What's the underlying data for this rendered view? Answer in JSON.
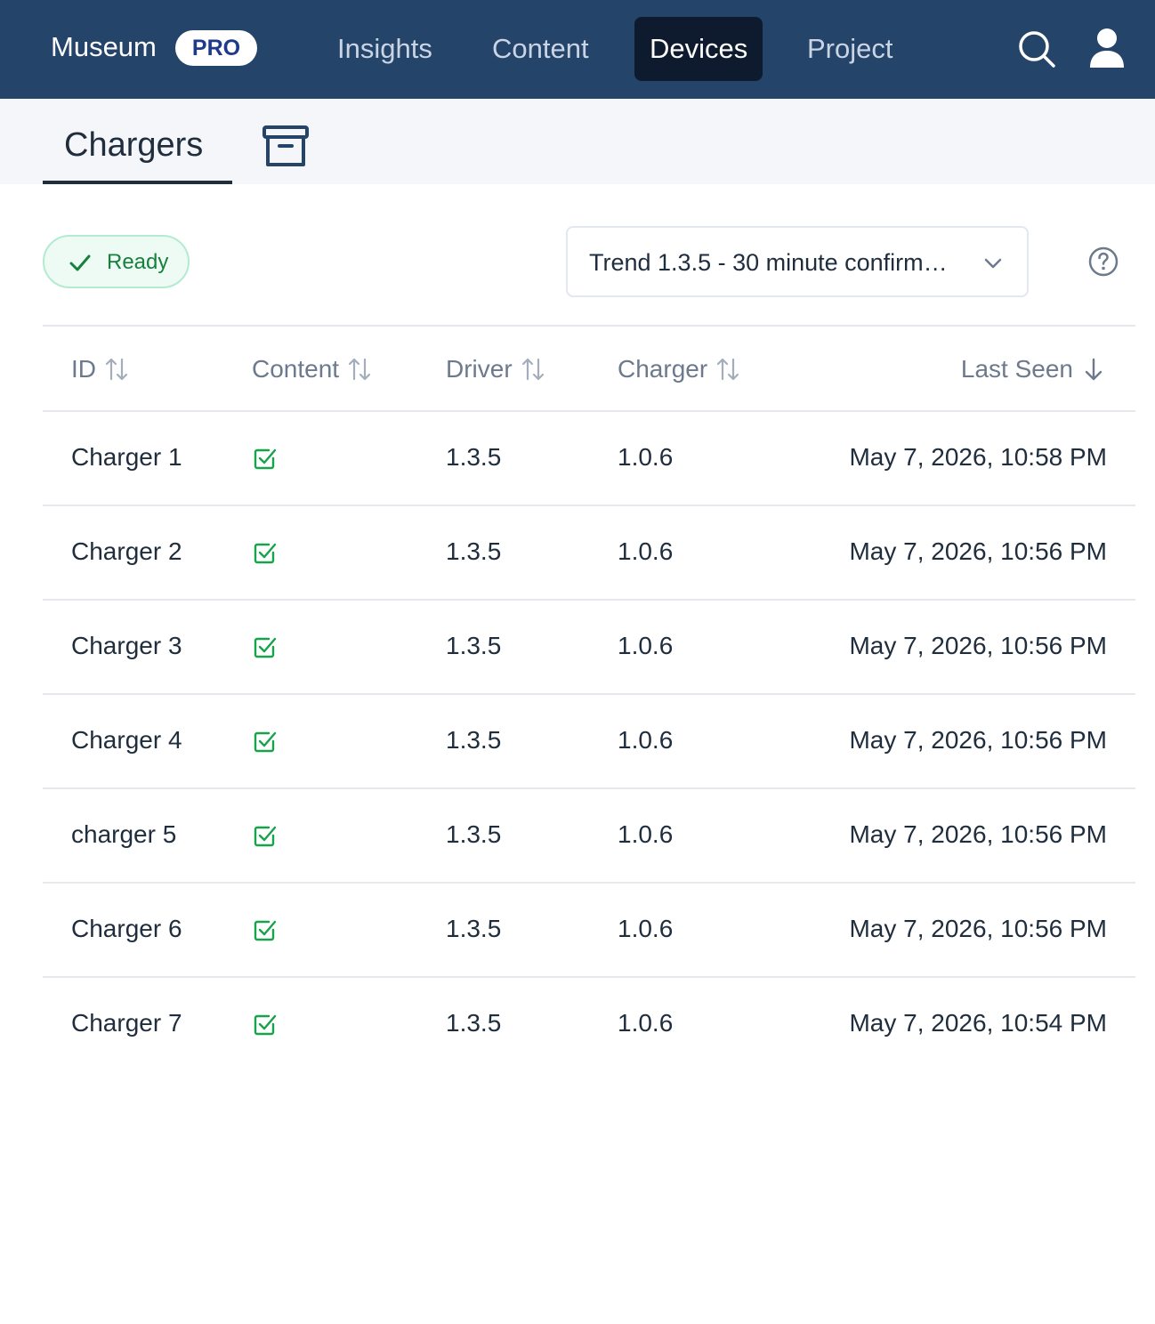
{
  "topnav": {
    "brand": "Museum",
    "badge": "PRO",
    "items": [
      {
        "label": "Insights",
        "active": false
      },
      {
        "label": "Content",
        "active": false
      },
      {
        "label": "Devices",
        "active": true
      },
      {
        "label": "Project",
        "active": false
      }
    ],
    "icons": [
      "search-icon",
      "user-icon"
    ]
  },
  "subheader": {
    "tab_label": "Chargers",
    "archive_icon": "archive-icon"
  },
  "filters": {
    "status_label": "Ready",
    "version_selected": "Trend 1.3.5 - 30 minute confirm…"
  },
  "table": {
    "headers": {
      "id": "ID",
      "content": "Content",
      "driver": "Driver",
      "charger": "Charger",
      "last_seen": "Last Seen"
    },
    "rows": [
      {
        "id": "Charger 1",
        "content": "check-square-icon",
        "driver": "1.3.5",
        "charger": "1.0.6",
        "last_seen": "May 7, 2026, 10:58 PM"
      },
      {
        "id": "Charger 2",
        "content": "check-square-icon",
        "driver": "1.3.5",
        "charger": "1.0.6",
        "last_seen": "May 7, 2026, 10:56 PM"
      },
      {
        "id": "Charger 3",
        "content": "check-square-icon",
        "driver": "1.3.5",
        "charger": "1.0.6",
        "last_seen": "May 7, 2026, 10:56 PM"
      },
      {
        "id": "Charger 4",
        "content": "check-square-icon",
        "driver": "1.3.5",
        "charger": "1.0.6",
        "last_seen": "May 7, 2026, 10:56 PM"
      },
      {
        "id": "charger 5",
        "content": "check-square-icon",
        "driver": "1.3.5",
        "charger": "1.0.6",
        "last_seen": "May 7, 2026, 10:56 PM"
      },
      {
        "id": "Charger 6",
        "content": "check-square-icon",
        "driver": "1.3.5",
        "charger": "1.0.6",
        "last_seen": "May 7, 2026, 10:56 PM"
      },
      {
        "id": "Charger 7",
        "content": "check-square-icon",
        "driver": "1.3.5",
        "charger": "1.0.6",
        "last_seen": "May 7, 2026, 10:54 PM"
      }
    ]
  },
  "colors": {
    "nav_bg": "#25446a",
    "nav_active_bg": "#0e1b2e",
    "success": "#16a34a",
    "text": "#1f2d3d"
  }
}
